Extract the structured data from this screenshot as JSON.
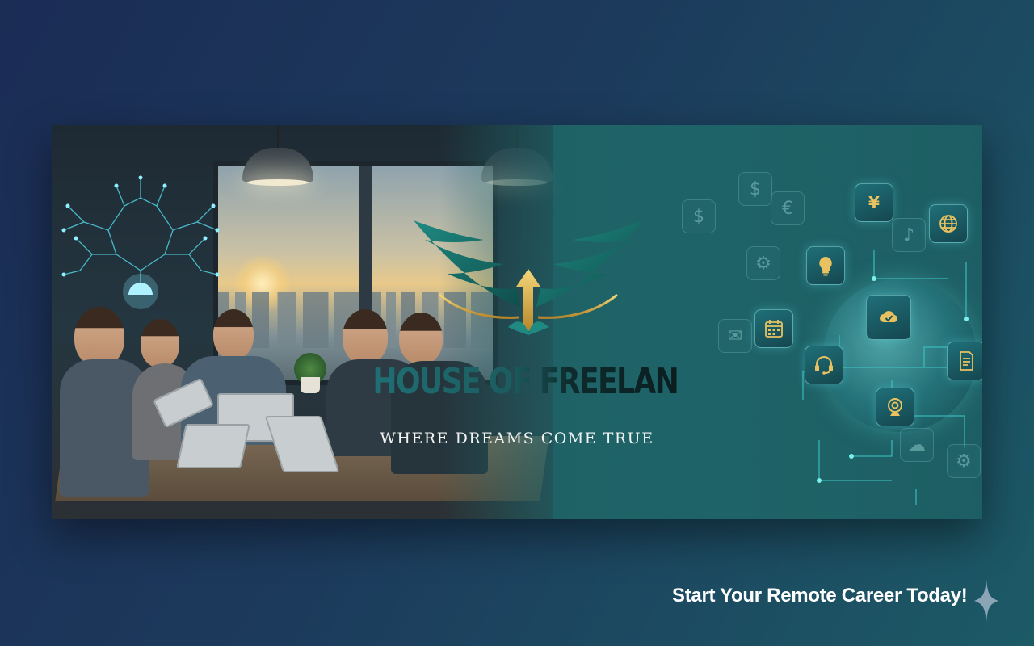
{
  "banner": {
    "brand_name": "HOUSE OF FREELANCERS",
    "tagline": "WHERE DREAMS COME TRUE",
    "logo_icon": "winged-arrow-icon",
    "icons": [
      "yen-icon",
      "globe-icon",
      "lightbulb-icon",
      "cloud-check-icon",
      "calendar-icon",
      "headset-icon",
      "document-icon",
      "webcam-icon",
      "circuit-brain-icon"
    ],
    "ghost_symbols": [
      "$",
      "€",
      "$",
      "⚙",
      "♪",
      "✉",
      "☁",
      "⚙"
    ]
  },
  "cta": {
    "text": "Start Your Remote Career Today!"
  },
  "colors": {
    "accent_teal": "#1f6f74",
    "logo_gold": "#d8b24a",
    "background_navy": "#1b2c55"
  }
}
